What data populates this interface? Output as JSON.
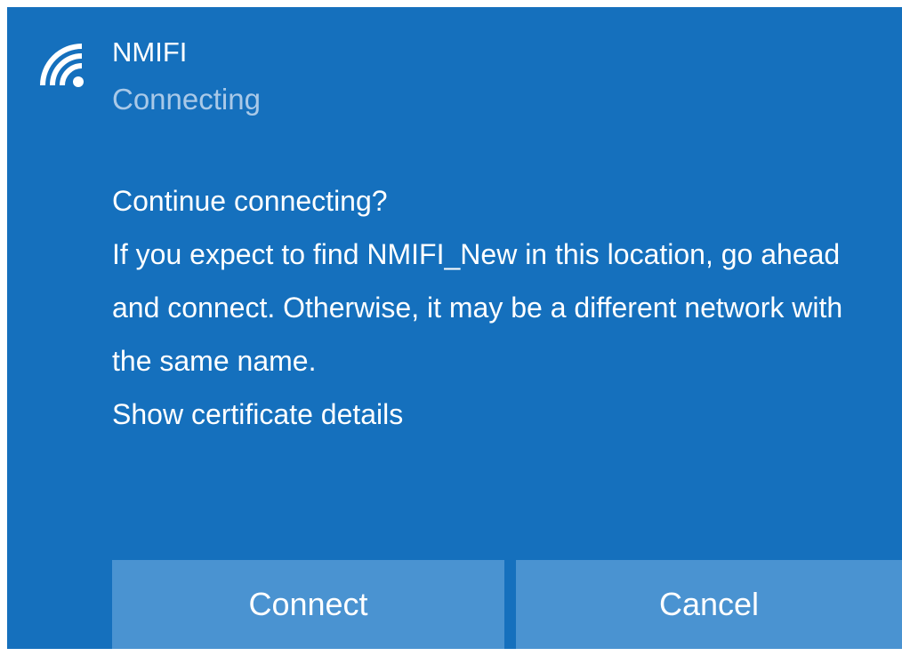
{
  "network": {
    "name": "NMIFI",
    "status": "Connecting",
    "icon": "wifi-icon"
  },
  "prompt": {
    "title": "Continue connecting?",
    "body": "If you expect to find NMIFI_New in this location, go ahead and connect. Otherwise, it may be a different network with the same name.",
    "certificate_link": "Show certificate details"
  },
  "buttons": {
    "connect_label": "Connect",
    "cancel_label": "Cancel"
  },
  "colors": {
    "panel_background": "#1570bd",
    "button_background": "#4a93d1",
    "status_text": "#a9c9e8",
    "text": "#ffffff"
  }
}
